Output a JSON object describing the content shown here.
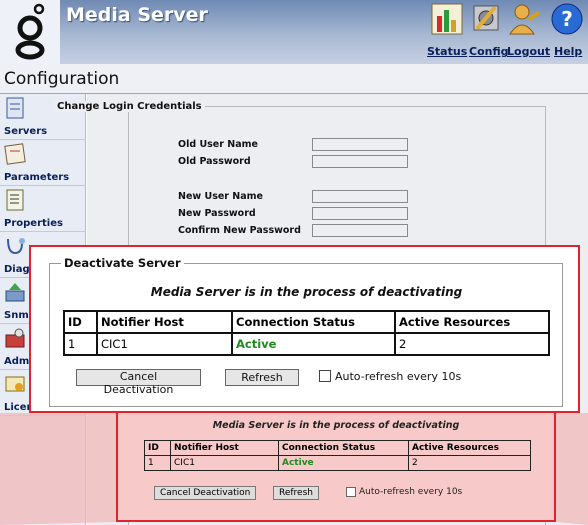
{
  "header": {
    "app_title": "Media Server",
    "links": {
      "status": "Status",
      "config": "Config",
      "logout": "Logout",
      "help": "Help"
    }
  },
  "page_title": "Configuration",
  "sidebar": {
    "items": [
      {
        "label": "Servers",
        "icon": "servers-icon"
      },
      {
        "label": "Parameters",
        "icon": "parameters-icon"
      },
      {
        "label": "Properties",
        "icon": "properties-icon"
      },
      {
        "label": "Diagr",
        "icon": "diagnostics-icon"
      },
      {
        "label": "Snmp",
        "icon": "snmp-icon"
      },
      {
        "label": "Admi",
        "icon": "admin-icon"
      },
      {
        "label": "Licen",
        "icon": "license-icon"
      }
    ]
  },
  "credentials": {
    "legend": "Change Login Credentials",
    "old_user_name": "Old User Name",
    "old_password": "Old Password",
    "new_user_name": "New User Name",
    "new_password": "New Password",
    "confirm_new_password": "Confirm New Password"
  },
  "dialog": {
    "legend": "Deactivate Server",
    "status": "Media Server is in the process of deactivating",
    "columns": [
      "ID",
      "Notifier Host",
      "Connection Status",
      "Active Resources"
    ],
    "rows": [
      {
        "id": "1",
        "host": "CIC1",
        "status": "Active",
        "resources": "2"
      }
    ],
    "cancel_label": "Cancel Deactivation",
    "refresh_label": "Refresh",
    "auto_refresh_label": "Auto-refresh every 10s",
    "auto_refresh_checked": false
  },
  "colors": {
    "accent_red": "#e0232d",
    "active_green": "#1f8a1f",
    "header_blue": "#6f8ab4"
  }
}
